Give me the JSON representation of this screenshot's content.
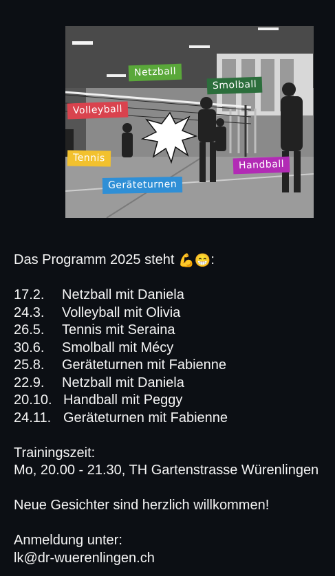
{
  "image": {
    "tags": {
      "netzball": "Netzball",
      "smolball": "Smolball",
      "volleyball": "Volleyball",
      "tennis": "Tennis",
      "handball": "Handball",
      "geraeteturnen": "Geräteturnen"
    },
    "tag_colors": {
      "netzball": "#5aa83a",
      "smolball": "#2c6e3c",
      "volleyball": "#d9434e",
      "tennis": "#f2c12e",
      "handball": "#b22bb5",
      "geraeteturnen": "#2f8fd6"
    }
  },
  "post": {
    "heading": "Das Programm 2025 steht",
    "heading_emojis": "💪😁",
    "heading_suffix": ":",
    "schedule": [
      {
        "date": "17.2.",
        "event": "Netzball mit Daniela"
      },
      {
        "date": "24.3.",
        "event": "Volleyball mit Olivia"
      },
      {
        "date": "26.5.",
        "event": "Tennis mit Seraina"
      },
      {
        "date": "30.6.",
        "event": "Smolball mit Mécy"
      },
      {
        "date": "25.8.",
        "event": "Geräteturnen mit Fabienne"
      },
      {
        "date": "22.9.",
        "event": "Netzball mit Daniela"
      },
      {
        "date": "20.10.",
        "event": "Handball mit Peggy"
      },
      {
        "date": "24.11.",
        "event": "Geräteturnen mit Fabienne"
      }
    ],
    "training_label": "Trainingszeit:",
    "training_details": "Mo, 20.00 - 21.30, TH Gartenstrasse Würenlingen",
    "welcome": "Neue Gesichter sind herzlich willkommen!",
    "signup_label": "Anmeldung unter:",
    "signup_email": "lk@dr-wuerenlingen.ch"
  }
}
